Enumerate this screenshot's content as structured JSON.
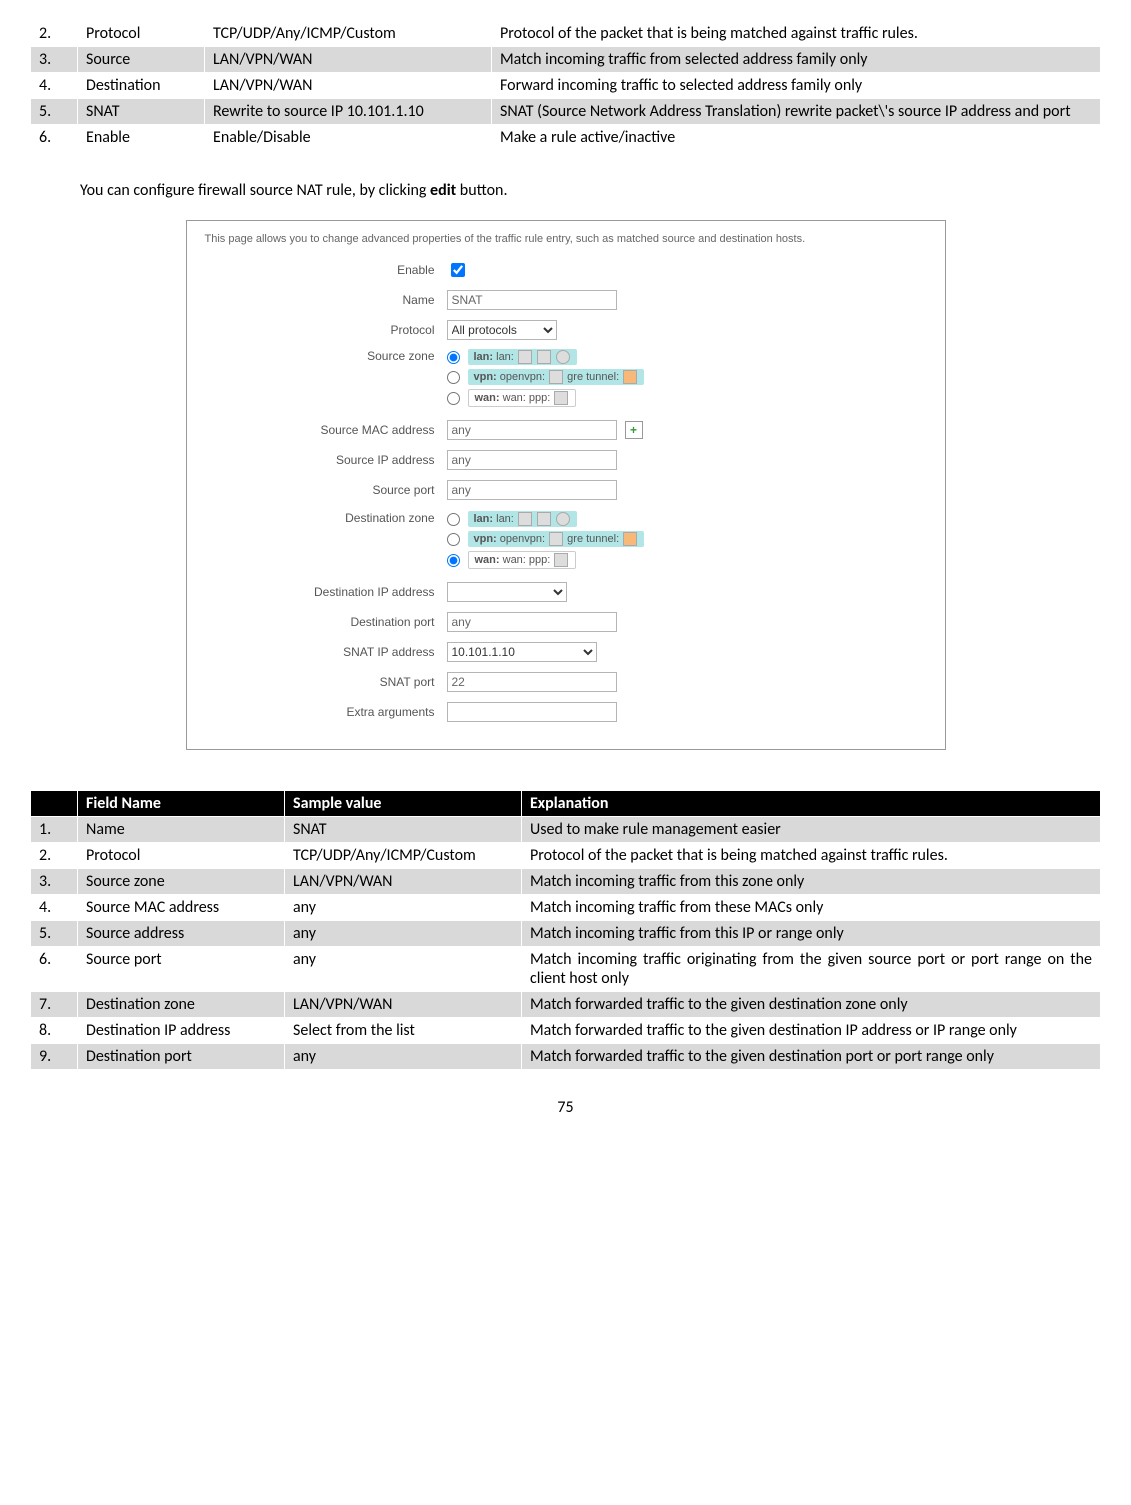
{
  "table1": {
    "rows": [
      {
        "num": "2.",
        "field": "Protocol",
        "sample": "TCP/UDP/Any/ICMP/Custom",
        "expl": "Protocol of the packet that is being matched against traffic rules."
      },
      {
        "num": "3.",
        "field": "Source",
        "sample": "LAN/VPN/WAN",
        "expl": "Match incoming traffic from selected address family only"
      },
      {
        "num": "4.",
        "field": "Destination",
        "sample": "LAN/VPN/WAN",
        "expl": "Forward incoming traffic to selected address family only"
      },
      {
        "num": "5.",
        "field": "SNAT",
        "sample": "Rewrite to source IP 10.101.1.10",
        "expl": "SNAT (Source Network Address Translation) rewrite packet\\'s source IP address and port"
      },
      {
        "num": "6.",
        "field": "Enable",
        "sample": "Enable/Disable",
        "expl": "Make a rule active/inactive"
      }
    ]
  },
  "intro": {
    "text_before": "You can configure firewall source NAT rule, by clicking ",
    "bold": "edit",
    "text_after": " button."
  },
  "screenshot": {
    "desc": "This page allows you to change advanced properties of the traffic rule entry, such as matched source and destination hosts.",
    "labels": {
      "enable": "Enable",
      "name": "Name",
      "protocol": "Protocol",
      "src_zone": "Source zone",
      "src_mac": "Source MAC address",
      "src_ip": "Source IP address",
      "src_port": "Source port",
      "dst_zone": "Destination zone",
      "dst_ip": "Destination IP address",
      "dst_port": "Destination port",
      "snat_ip": "SNAT IP address",
      "snat_port": "SNAT port",
      "extra": "Extra arguments"
    },
    "values": {
      "name": "SNAT",
      "protocol": "All protocols",
      "any": "any",
      "snat_ip": "10.101.1.10",
      "snat_port": "22"
    },
    "zones": {
      "lan_pre": "lan:",
      "lan_post": " lan: ",
      "vpn_pre": "vpn:",
      "vpn_mid": " openvpn: ",
      "vpn_post": " gre tunnel: ",
      "wan_pre": "wan:",
      "wan_post": " wan:   ppp: "
    }
  },
  "table2": {
    "headers": {
      "c1": "",
      "c2": "Field Name",
      "c3": "Sample value",
      "c4": "Explanation"
    },
    "rows": [
      {
        "num": "1.",
        "field": "Name",
        "sample": "SNAT",
        "expl": "Used to make rule management easier"
      },
      {
        "num": "2.",
        "field": "Protocol",
        "sample": "TCP/UDP/Any/ICMP/Custom",
        "expl": "Protocol of the packet that is being matched against traffic rules."
      },
      {
        "num": "3.",
        "field": "Source zone",
        "sample": "LAN/VPN/WAN",
        "expl": "Match incoming traffic from this zone only"
      },
      {
        "num": "4.",
        "field": "Source MAC address",
        "sample": "any",
        "expl": "Match incoming traffic from these MACs only"
      },
      {
        "num": "5.",
        "field": "Source address",
        "sample": "any",
        "expl": "Match incoming traffic from this IP or range only"
      },
      {
        "num": "6.",
        "field": "Source port",
        "sample": "any",
        "expl": "Match incoming traffic originating from the given source port or port range on the client host only"
      },
      {
        "num": "7.",
        "field": "Destination zone",
        "sample": "LAN/VPN/WAN",
        "expl": "Match forwarded traffic to the given destination zone only"
      },
      {
        "num": "8.",
        "field": "Destination IP address",
        "sample": "Select from the list",
        "expl": "Match forwarded traffic to the given destination IP address or IP range only"
      },
      {
        "num": "9.",
        "field": "Destination port",
        "sample": "any",
        "expl": "Match forwarded traffic to the given destination port or port range only"
      }
    ]
  },
  "page_number": "75"
}
